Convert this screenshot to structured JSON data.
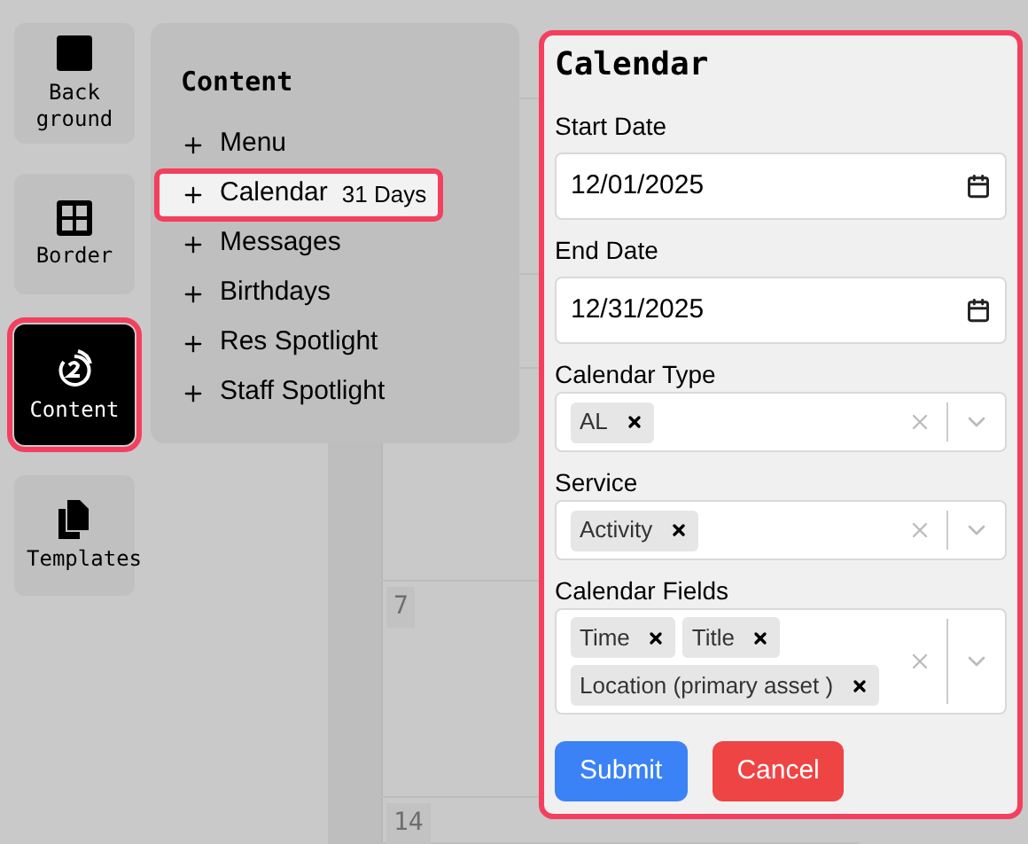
{
  "toolbar": [
    {
      "label": "Back ground",
      "kind": "square",
      "selected": false
    },
    {
      "label": "Border",
      "kind": "grid",
      "selected": false
    },
    {
      "label": "Content",
      "kind": "content",
      "selected": true
    },
    {
      "label": "Templates",
      "kind": "files",
      "selected": false
    }
  ],
  "content_panel": {
    "title": "Content",
    "items": [
      {
        "label": "Menu",
        "selected": false
      },
      {
        "label": "Calendar",
        "badge": "31 Days",
        "selected": true
      },
      {
        "label": "Messages",
        "selected": false
      },
      {
        "label": "Birthdays",
        "selected": false
      },
      {
        "label": "Res Spotlight",
        "selected": false
      },
      {
        "label": "Staff Spotlight",
        "selected": false
      }
    ]
  },
  "calendar_days": [
    "7",
    "14"
  ],
  "form": {
    "title": "Calendar",
    "fields": [
      {
        "kind": "date",
        "label": "Start Date",
        "value": "12/01/2025"
      },
      {
        "kind": "date",
        "label": "End Date",
        "value": "12/31/2025"
      },
      {
        "kind": "multiselect",
        "label": "Calendar Type",
        "tags": [
          "AL"
        ]
      },
      {
        "kind": "multiselect",
        "label": "Service",
        "tags": [
          "Activity"
        ]
      },
      {
        "kind": "multiselect",
        "label": "Calendar Fields",
        "tags": [
          "Time",
          "Title",
          "Location (primary asset )"
        ]
      }
    ],
    "buttons": [
      {
        "label": "Submit",
        "kind": "primary"
      },
      {
        "label": "Cancel",
        "kind": "danger"
      }
    ]
  }
}
